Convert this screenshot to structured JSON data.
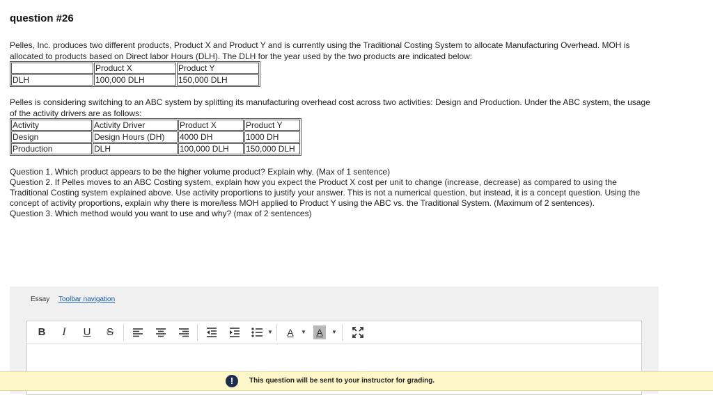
{
  "question": {
    "title": "question #26",
    "intro": "Pelles, Inc. produces two different products, Product X and Product Y and is currently using the Traditional Costing System to allocate Manufacturing Overhead. MOH is allocated to products based on Direct labor Hours (DLH). The DLH for the year used by the two products are indicated below:",
    "table1": {
      "headers": [
        "",
        "Product X",
        "Product Y"
      ],
      "rows": [
        [
          "DLH",
          "100,000 DLH",
          "150,000 DLH"
        ]
      ]
    },
    "abc_intro": "Pelles is considering switching to an ABC system by splitting its manufacturing overhead cost across two activities: Design and Production. Under the ABC system, the usage of the activity drivers are as follows:",
    "table2": {
      "headers": [
        "Activity",
        "Activity Driver",
        "Product X",
        "Product Y"
      ],
      "rows": [
        [
          "Design",
          "Design Hours (DH)",
          "4000 DH",
          "1000 DH"
        ],
        [
          "Production",
          "DLH",
          "100,000 DLH",
          "150,000 DLH"
        ]
      ]
    },
    "q1": "Question 1.  Which product appears to be the higher volume product? Explain why. (Max of 1 sentence)",
    "q2": "Question 2.  If Pelles moves to an ABC Costing system, explain how you expect the Product X cost per unit to change (increase, decrease) as compared to using the Traditional Costing system explained above. Use activity proportions to justify your answer. This is not a numerical question, but instead, it is a concept question. Using the concept of activity proportions, explain why there is more/less MOH applied to Product Y using the ABC vs. the Traditional System. (Maximum of 2 sentences).",
    "q3": "Question 3. Which method would you want to use and why? (max of 2 sentences)"
  },
  "essay": {
    "label": "Essay",
    "toolbar_nav": "Toolbar navigation",
    "buttons": {
      "bold": "B",
      "italic": "I",
      "underline": "U",
      "strike": "S",
      "font_color": "A",
      "highlight": "A"
    },
    "highlight_color": "#b8b8b8"
  },
  "notice": {
    "icon": "!",
    "text": "This question will be sent to your instructor for grading."
  }
}
